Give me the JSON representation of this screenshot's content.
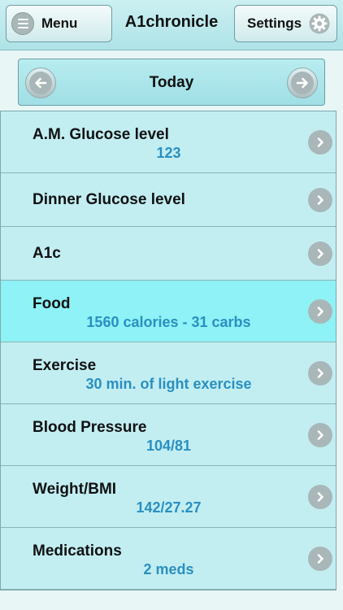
{
  "header": {
    "menu_label": "Menu",
    "title": "A1chronicle",
    "settings_label": "Settings"
  },
  "date_nav": {
    "label": "Today"
  },
  "items": [
    {
      "label": "A.M. Glucose level",
      "value": "123"
    },
    {
      "label": "Dinner Glucose level",
      "value": ""
    },
    {
      "label": "A1c",
      "value": ""
    },
    {
      "label": "Food",
      "value": "1560 calories - 31 carbs"
    },
    {
      "label": "Exercise",
      "value": "30 min. of light exercise"
    },
    {
      "label": "Blood Pressure",
      "value": "104/81"
    },
    {
      "label": "Weight/BMI",
      "value": "142/27.27"
    },
    {
      "label": "Medications",
      "value": "2 meds"
    }
  ],
  "colors": {
    "accent_value_text": "#2a8fc0",
    "row_background": "#c2eef2",
    "row_selected_background": "#8ef2f6"
  }
}
